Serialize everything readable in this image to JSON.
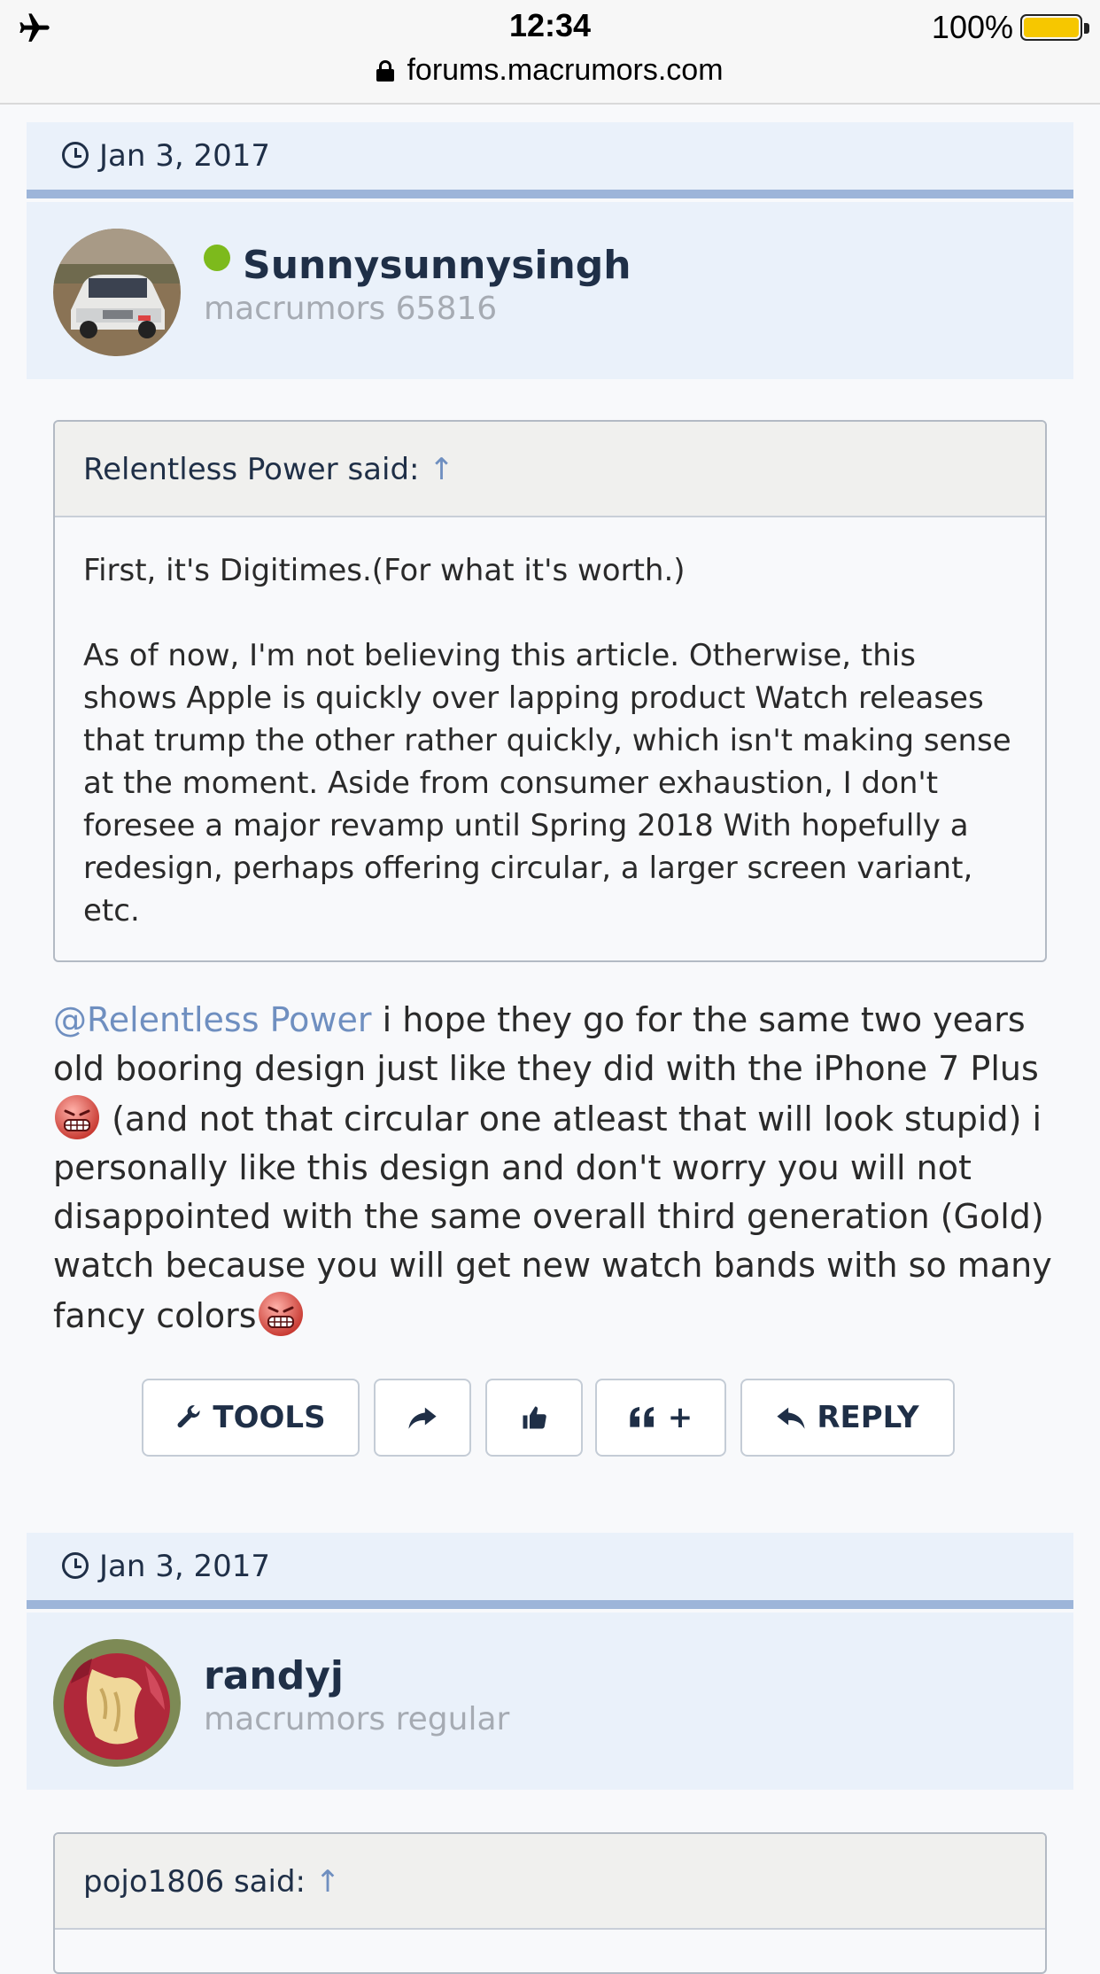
{
  "status_bar": {
    "time": "12:34",
    "battery": "100%",
    "url": "forums.macrumors.com",
    "battery_color": "#f6c700"
  },
  "posts": [
    {
      "date": "Jan 3, 2017",
      "username": "Sunnysunnysingh",
      "user_title": "macrumors 65816",
      "online": true,
      "quote": {
        "author_label": "Relentless Power said:",
        "arrow": "↑",
        "paragraphs": [
          "First, it's Digitimes.(For what it's worth.)",
          "As of now, I'm not believing this article. Otherwise, this shows Apple is quickly over lapping product Watch releases that trump the other rather quickly, which isn't making sense at the moment. Aside from consumer exhaustion, I don't foresee a major revamp until Spring 2018 With hopefully a redesign, perhaps offering circular, a larger screen variant, etc."
        ]
      },
      "message": {
        "mention": "@Relentless Power",
        "text1": " i hope they go for the same two years old booring design just like they did with the iPhone 7 Plus ",
        "text2": " (and not that circular one atleast that will look stupid) i personally like this design and don't worry you will not disappointed with the same overall third generation (Gold) watch because you will get new watch bands with so many fancy colors"
      },
      "actions": {
        "tools": "TOOLS",
        "quote_plus": "+",
        "reply": "REPLY"
      }
    },
    {
      "date": "Jan 3, 2017",
      "username": "randyj",
      "user_title": "macrumors regular",
      "online": false,
      "quote": {
        "author_label": "pojo1806 said:",
        "arrow": "↑"
      }
    }
  ],
  "icons": [
    "airplane-icon",
    "lock-icon",
    "clock-icon",
    "wrench-icon",
    "share-icon",
    "thumbs-up-icon",
    "quote-icon",
    "reply-icon",
    "grimace-emoji"
  ]
}
